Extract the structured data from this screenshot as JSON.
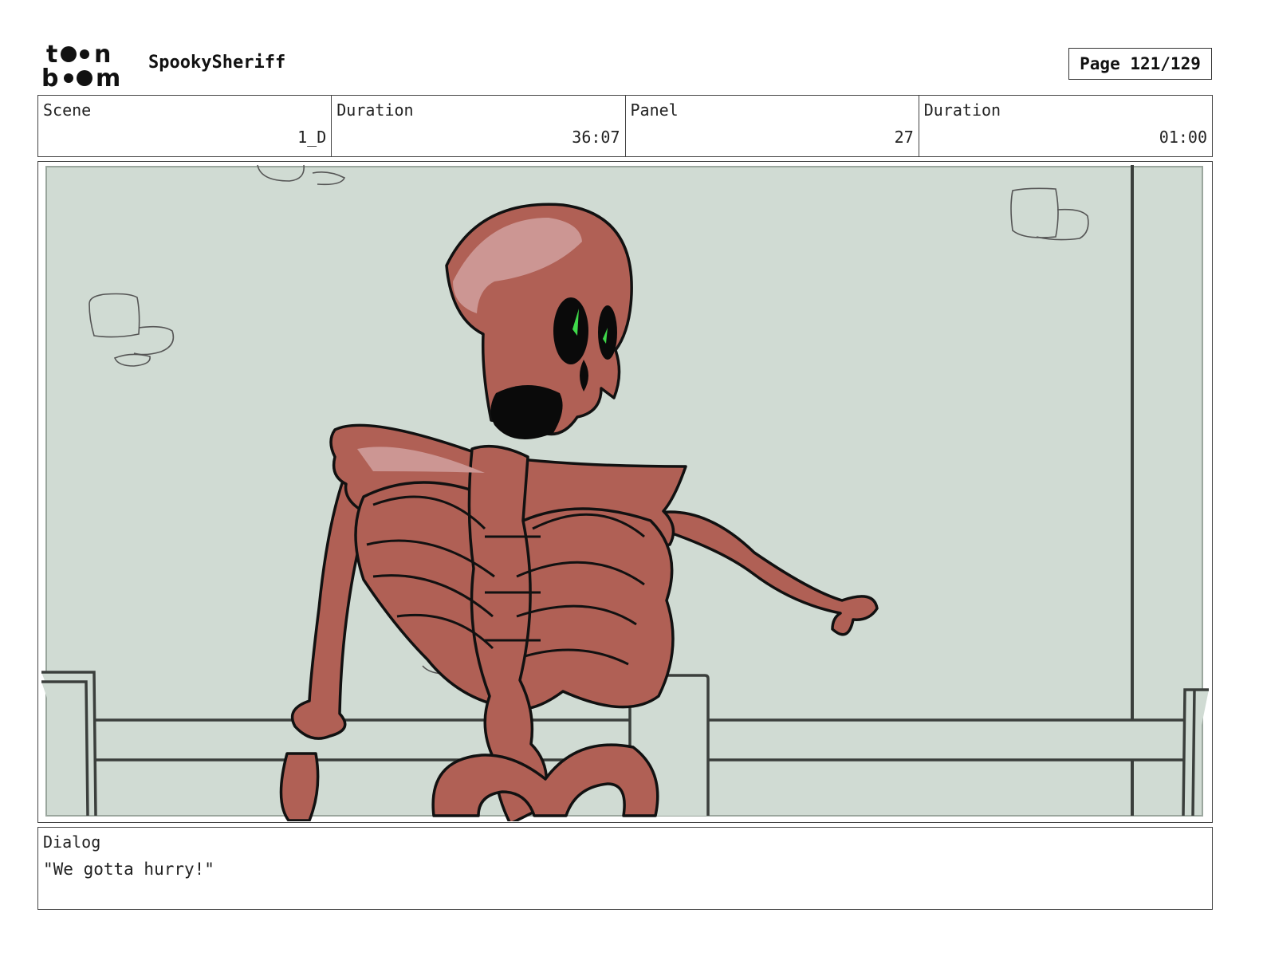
{
  "header": {
    "logo_text": [
      "toon",
      "boom"
    ],
    "project_title": "SpookySheriff",
    "page_label": "Page 121/129"
  },
  "info": {
    "scene_label": "Scene",
    "scene_value": "1_D",
    "scene_duration_label": "Duration",
    "scene_duration_value": "36:07",
    "panel_label": "Panel",
    "panel_value": "27",
    "panel_duration_label": "Duration",
    "panel_duration_value": "01:00"
  },
  "panel": {
    "background_color": "#d0dbd3",
    "figure_color": "#b06055",
    "eye_color": "#3fd94a"
  },
  "dialog": {
    "label": "Dialog",
    "text": "\"We gotta hurry!\""
  }
}
